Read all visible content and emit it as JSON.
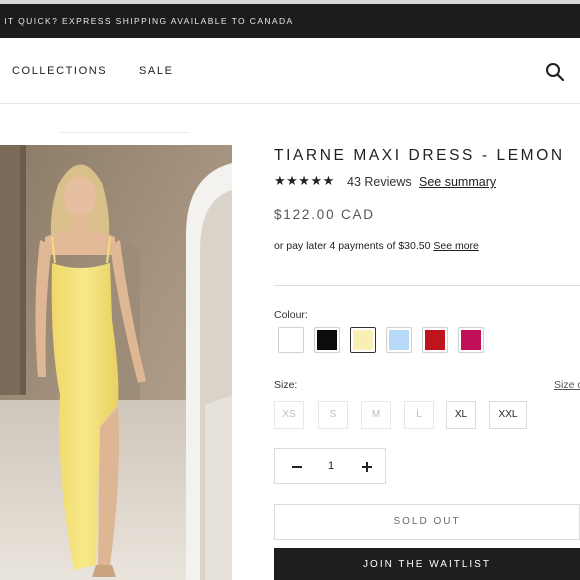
{
  "announcement": "T IT QUICK? EXPRESS SHIPPING AVAILABLE TO CANADA",
  "nav": {
    "collections": "COLLECTIONS",
    "sale": "SALE"
  },
  "product": {
    "title": "TIARNE MAXI DRESS - LEMON",
    "rating_stars": "★★★★★",
    "rating_value": 5,
    "reviews": "43 Reviews",
    "see_summary": "See summary",
    "price": "$122.00 CAD",
    "paylater_text": "or pay later 4 payments of $30.50 ",
    "paylater_link": "See more"
  },
  "colour": {
    "label": "Colour:",
    "swatches": [
      {
        "name": "white",
        "hex": "#ffffff"
      },
      {
        "name": "black",
        "hex": "#0d0d0d"
      },
      {
        "name": "lemon",
        "hex": "#f7efb6",
        "selected": true
      },
      {
        "name": "light-blue",
        "hex": "#b9daf7"
      },
      {
        "name": "red",
        "hex": "#c0141d"
      },
      {
        "name": "magenta",
        "hex": "#c20f5a"
      }
    ]
  },
  "size": {
    "label": "Size:",
    "chart_link": "Size c",
    "options": [
      {
        "label": "XS",
        "available": false
      },
      {
        "label": "S",
        "available": false
      },
      {
        "label": "M",
        "available": false
      },
      {
        "label": "L",
        "available": false
      },
      {
        "label": "XL",
        "available": true
      },
      {
        "label": "XXL",
        "available": true
      }
    ]
  },
  "quantity": {
    "value": "1"
  },
  "buttons": {
    "sold_out": "SOLD OUT",
    "waitlist": "JOIN THE WAITLIST"
  },
  "colors": {
    "announcement_bg": "#1c1c1c",
    "button_dark": "#1e1e1e",
    "dress": "#f5e37e"
  }
}
